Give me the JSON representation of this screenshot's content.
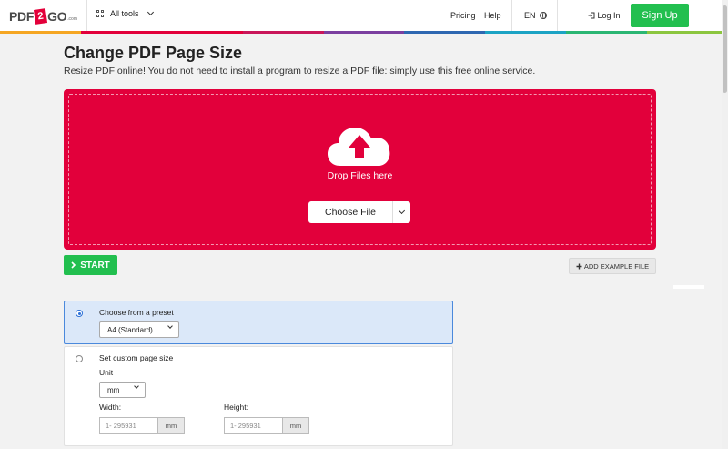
{
  "header": {
    "logo": {
      "pre": "PDF",
      "two": "2",
      "post": "GO",
      "suffix": ".com"
    },
    "all_tools": "All tools",
    "pricing": "Pricing",
    "help": "Help",
    "language": "EN",
    "login": "Log In",
    "signup": "Sign Up",
    "rainbow_colors": [
      "#f5a623",
      "#e2003b",
      "#e2003b",
      "#c9165a",
      "#7b3fa0",
      "#2e67b1",
      "#1ca3c4",
      "#2bb673",
      "#8cc63f"
    ]
  },
  "main": {
    "title": "Change PDF Page Size",
    "subtitle": "Resize PDF online! You do not need to install a program to resize a PDF file: simply use this free online service.",
    "dropzone": {
      "text": "Drop Files here",
      "choose_file": "Choose File",
      "color": "#e2003b"
    },
    "start": "START",
    "add_example": "ADD EXAMPLE FILE"
  },
  "options": {
    "preset": {
      "label": "Choose from a preset",
      "selected": "A4 (Standard)"
    },
    "custom": {
      "label": "Set custom page size",
      "unit_label": "Unit",
      "unit_value": "mm",
      "width_label": "Width:",
      "height_label": "Height:",
      "width_placeholder": "1- 295931",
      "height_placeholder": "1- 295931",
      "width_unit": "mm",
      "height_unit": "mm"
    }
  }
}
